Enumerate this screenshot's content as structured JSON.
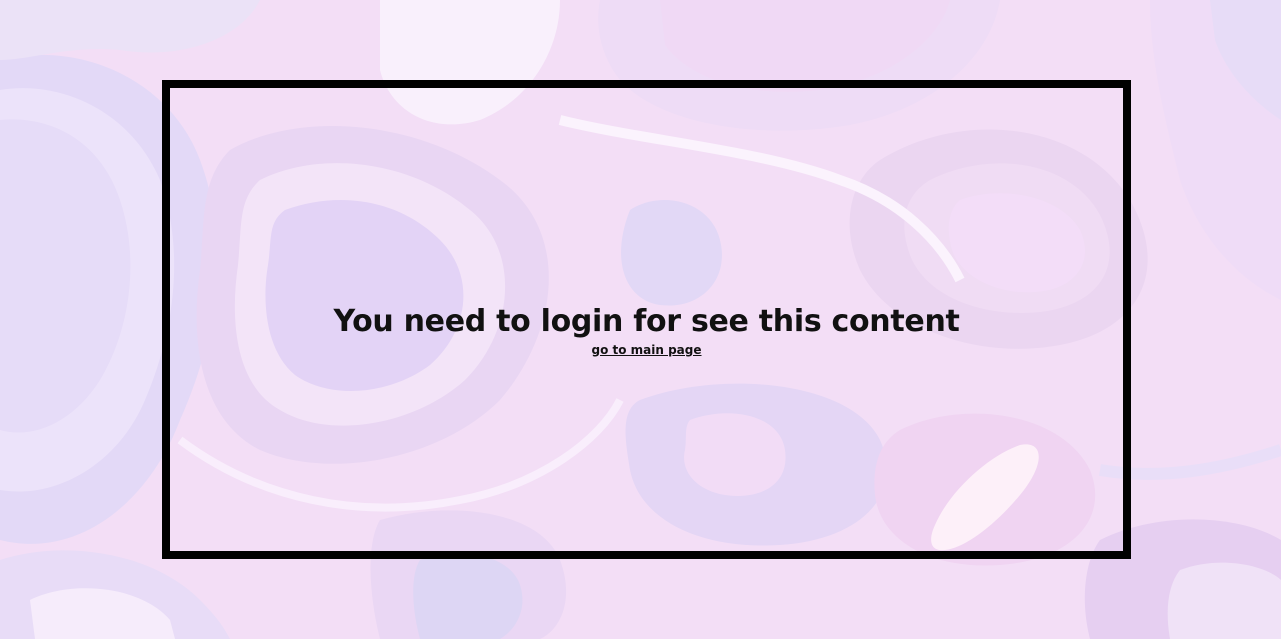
{
  "message": {
    "title": "You need to login for see this content",
    "link_label": "go to main page"
  },
  "colors": {
    "frame_border": "#000000",
    "text": "#111111",
    "background_base": "#f3def6"
  }
}
